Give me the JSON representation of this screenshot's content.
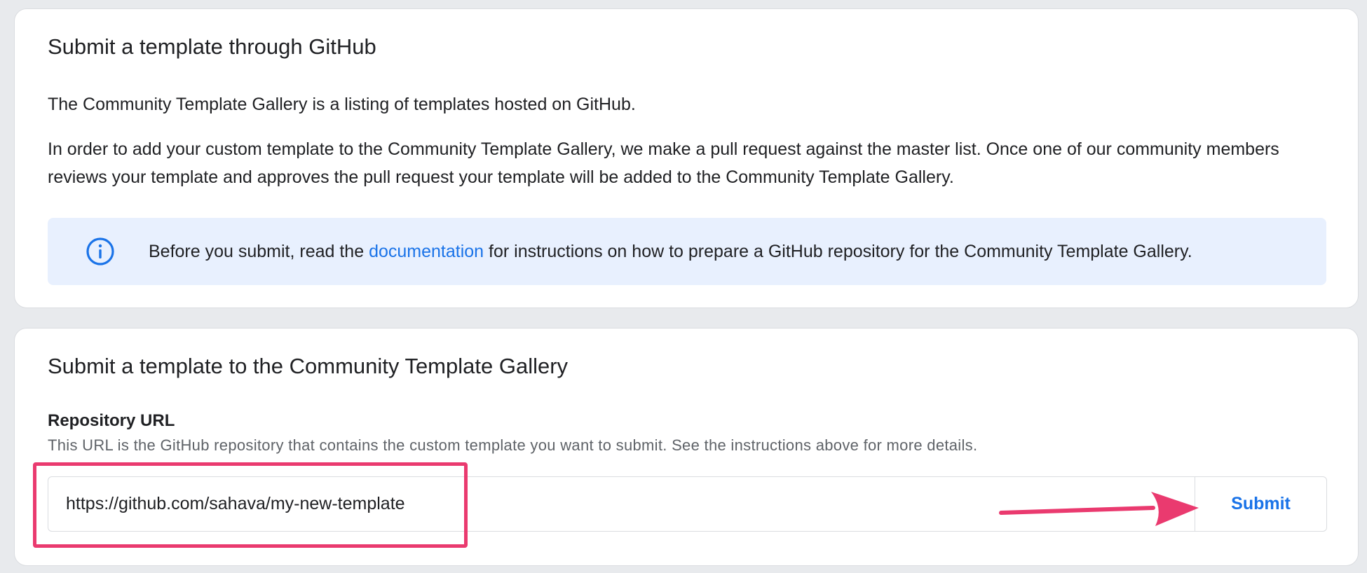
{
  "github_card": {
    "title": "Submit a template through GitHub",
    "paragraph_1": "The Community Template Gallery is a listing of templates hosted on GitHub.",
    "paragraph_2": "In order to add your custom template to the Community Template Gallery, we make a pull request against the master list. Once one of our community members reviews your template and approves the pull request your template will be added to the Community Template Gallery.",
    "info": {
      "icon": "info-icon",
      "text_before": "Before you submit, read the ",
      "link_label": "documentation",
      "text_after": " for instructions on how to prepare a GitHub repository for the Community Template Gallery."
    }
  },
  "submit_card": {
    "title": "Submit a template to the Community Template Gallery",
    "field_label": "Repository URL",
    "field_help": "This URL is the GitHub repository that contains the custom template you want to submit. See the instructions above for more details.",
    "url_value": "https://github.com/sahava/my-new-template",
    "submit_label": "Submit"
  },
  "annotation": {
    "color": "#ea3a6f"
  },
  "colors": {
    "accent": "#1a73e8",
    "info_background": "#e8f0fe"
  }
}
